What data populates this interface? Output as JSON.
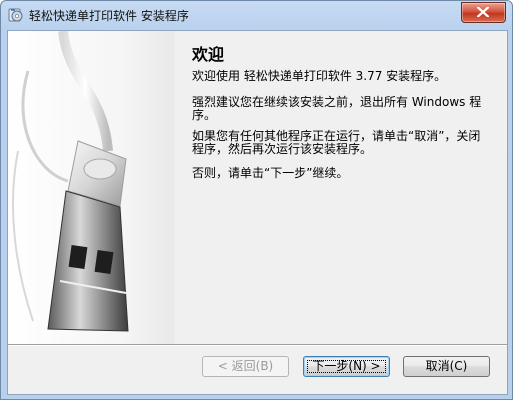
{
  "window": {
    "title": "轻松快递单打印软件 安装程序",
    "app_icon": "installer-disc-icon",
    "close_icon": "close-icon"
  },
  "sidebar": {
    "image": "usb-flash-drive-image"
  },
  "content": {
    "heading": "欢迎",
    "paragraphs": [
      "欢迎使用 轻松快递单打印软件 3.77 安装程序。",
      "强烈建议您在继续该安装之前，退出所有 Windows 程序。",
      "如果您有任何其他程序正在运行，请单击“取消”，关闭程序，然后再次运行该安装程序。",
      "否则，请单击“下一步”继续。"
    ]
  },
  "buttons": {
    "back": "< 返回(B)",
    "next": "下一步(N) >",
    "cancel": "取消(C)"
  },
  "colors": {
    "title_bar": "#b9d1ee",
    "close_button": "#c1361f",
    "panel_bg": "#f0f0f0"
  }
}
